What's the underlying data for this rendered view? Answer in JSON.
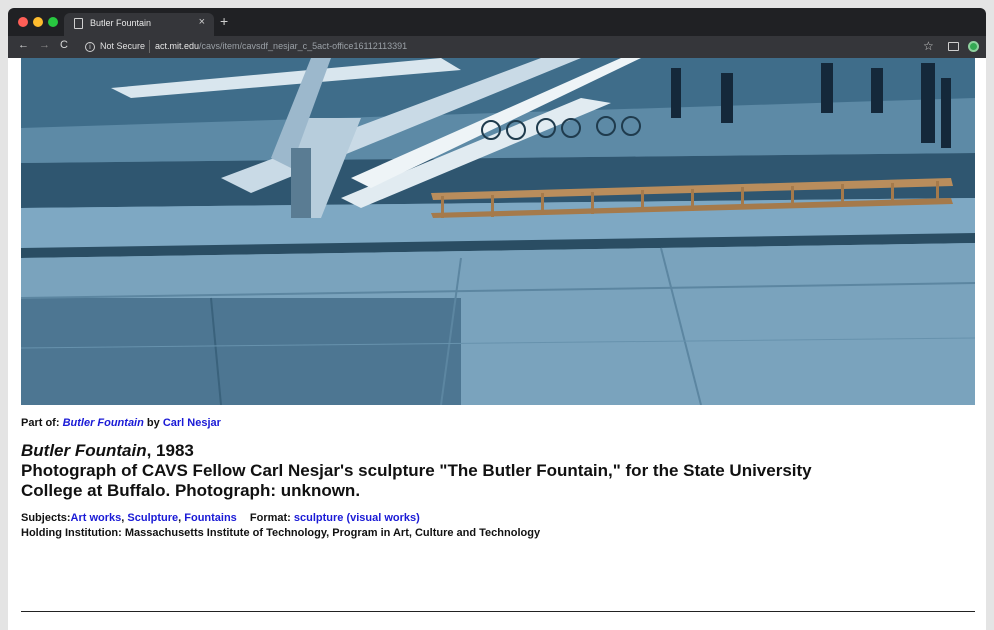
{
  "browser": {
    "tab_title": "Butler Fountain",
    "tab_close": "×",
    "new_tab": "+",
    "security_label": "Not Secure",
    "url_host": "act.mit.edu",
    "url_path": "/cavs/item/cavsdf_nesjar_c_5act-office16112113391"
  },
  "image": {
    "description_icon": "photo"
  },
  "part_of": {
    "label": "Part of:",
    "collection": "Butler Fountain",
    "by": "by",
    "artist": "Carl Nesjar"
  },
  "item": {
    "title": "Butler Fountain",
    "year": ", 1983",
    "description": "Photograph of CAVS Fellow Carl Nesjar's sculpture \"The Butler Fountain,\" for the State University College at Buffalo. Photograph: unknown."
  },
  "meta": {
    "subjects_label": "Subjects:",
    "subjects": [
      "Art works",
      "Sculpture",
      "Fountains"
    ],
    "subject_separator": ",",
    "format_label": "Format:",
    "format": "sculpture (visual works)",
    "holding_label": "Holding Institution:",
    "holding": "Massachusetts Institute of Technology, Program in Art, Culture and Technology"
  },
  "colors": {
    "link": "#1a1ad6",
    "chrome": "#202124"
  }
}
